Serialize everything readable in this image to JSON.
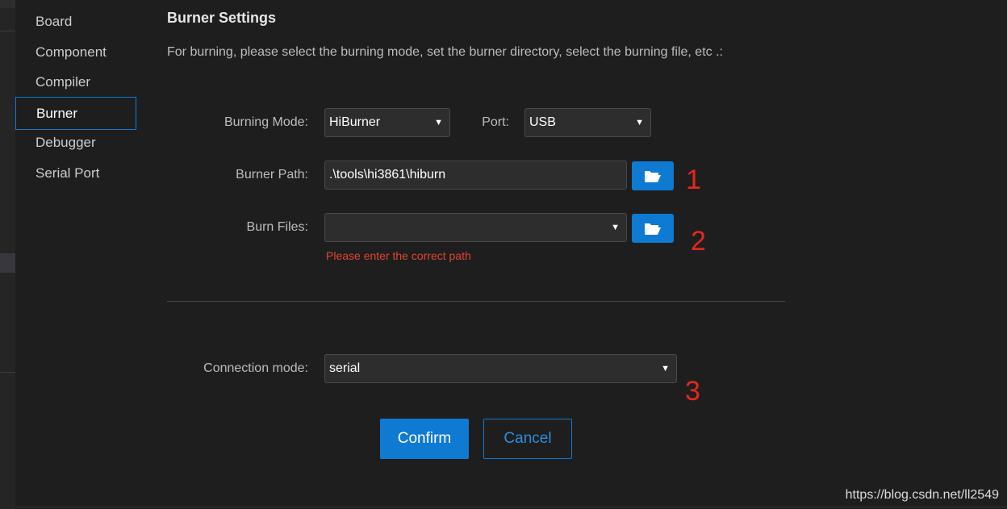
{
  "nav": {
    "items": [
      {
        "label": "Board"
      },
      {
        "label": "Component"
      },
      {
        "label": "Compiler"
      },
      {
        "label": "Burner",
        "active": true
      },
      {
        "label": "Debugger"
      },
      {
        "label": "Serial Port"
      }
    ]
  },
  "settings": {
    "title": "Burner Settings",
    "description": "For burning, please select the burning mode, set the burner directory, select the burning file, etc .:",
    "burning_mode_label": "Burning Mode:",
    "burning_mode_value": "HiBurner",
    "port_label": "Port:",
    "port_value": "USB",
    "burner_path_label": "Burner Path:",
    "burner_path_value": ".\\tools\\hi3861\\hiburn",
    "burn_files_label": "Burn Files:",
    "burn_files_value": "",
    "burn_files_error": "Please enter the correct path",
    "connection_mode_label": "Connection mode:",
    "connection_mode_value": "serial"
  },
  "buttons": {
    "confirm": "Confirm",
    "cancel": "Cancel"
  },
  "annotations": [
    "1",
    "2",
    "3"
  ],
  "watermark": "https://blog.csdn.net/ll2549",
  "colors": {
    "accent": "#0e7ad2",
    "error": "#e0452f",
    "annotation": "#e8261e",
    "background": "#1e1e1e"
  },
  "icons": {
    "folder": "folder-open-icon",
    "dropdown": "triangle-down-icon"
  }
}
